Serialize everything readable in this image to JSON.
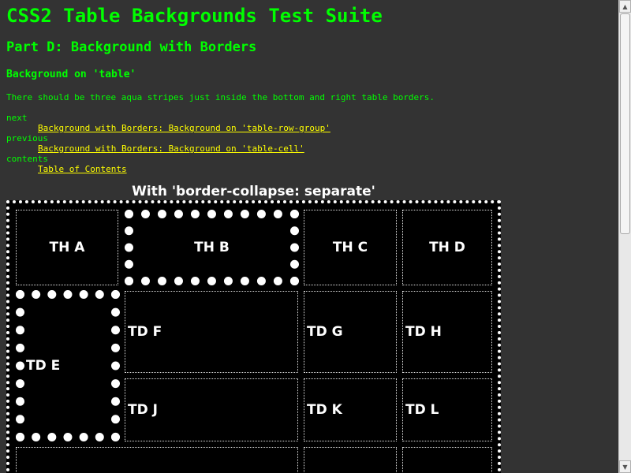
{
  "page": {
    "title": "CSS2 Table Backgrounds Test Suite",
    "subtitle": "Part D: Background with Borders",
    "section": "Background on 'table'",
    "assertion": "There should be three aqua stripes just inside the bottom and right table borders."
  },
  "nav": {
    "next_term": "next",
    "next_link": "Background with Borders: Background on 'table-row-group'",
    "previous_term": "previous",
    "previous_link": "Background with Borders: Background on 'table-cell'",
    "contents_term": "contents",
    "contents_link": "Table of Contents"
  },
  "table": {
    "caption": "With 'border-collapse: separate'",
    "headers": [
      "TH A",
      "TH B",
      "TH C",
      "TH D"
    ],
    "row1": [
      "TD E",
      "TD F",
      "TD G",
      "TD H"
    ],
    "row2": [
      "TD J",
      "TD K",
      "TD L"
    ]
  },
  "colors": {
    "background": "#333333",
    "heading": "#00ff00",
    "link": "#ffff00",
    "table_bg": "#000000",
    "border": "#ffffff"
  },
  "icons": {
    "scroll_up": "arrow-up-icon",
    "scroll_down": "arrow-down-icon"
  }
}
